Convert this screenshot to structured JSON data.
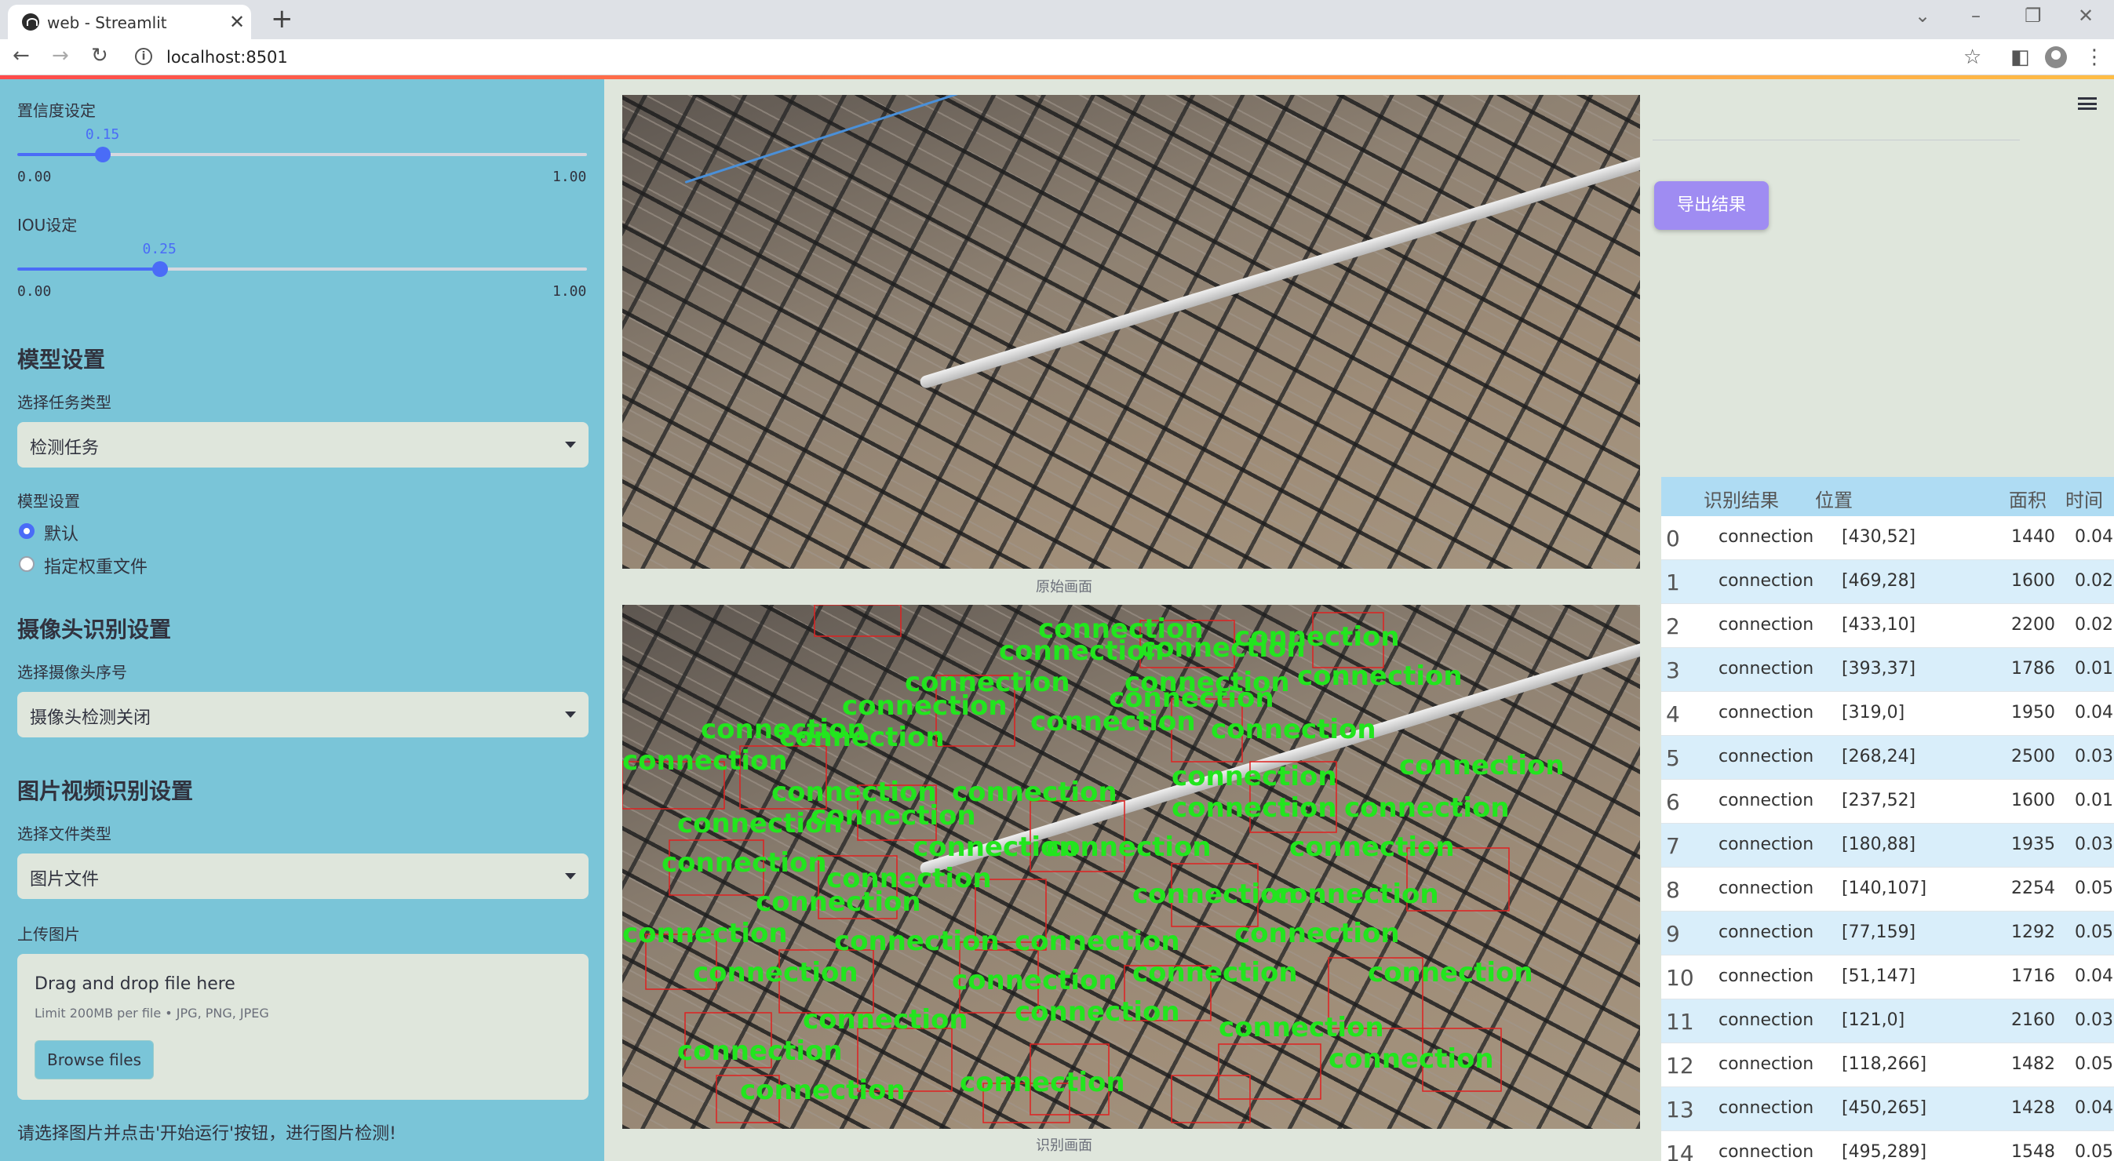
{
  "browser": {
    "tab_title": "web - Streamlit",
    "url": "localhost:8501"
  },
  "sidebar": {
    "confidence": {
      "label": "置信度设定",
      "value": "0.15",
      "fraction": 0.15,
      "min": "0.00",
      "max": "1.00"
    },
    "iou": {
      "label": "IOU设定",
      "value": "0.25",
      "fraction": 0.25,
      "min": "0.00",
      "max": "1.00"
    },
    "model_heading": "模型设置",
    "task_label": "选择任务类型",
    "task_value": "检测任务",
    "model_label": "模型设置",
    "model_options": [
      {
        "label": "默认",
        "checked": true
      },
      {
        "label": "指定权重文件",
        "checked": false
      }
    ],
    "camera_heading": "摄像头识别设置",
    "camera_label": "选择摄像头序号",
    "camera_value": "摄像头检测关闭",
    "media_heading": "图片视频识别设置",
    "filetype_label": "选择文件类型",
    "filetype_value": "图片文件",
    "upload_label": "上传图片",
    "upload_title": "Drag and drop file here",
    "upload_limit": "Limit 200MB per file • JPG, PNG, JPEG",
    "browse_label": "Browse files",
    "footer_hint": "请选择图片并点击'开始运行'按钮，进行图片检测!"
  },
  "main": {
    "original_caption": "原始画面",
    "detected_caption": "识别画面",
    "detection_label": "connection",
    "export_label": "导出结果",
    "colors": {
      "accent": "#4a6cf7",
      "sidebar": "#7ac5d8",
      "detection_text": "#22e51e",
      "detection_box": "#e02020",
      "export_button": "#9f8cf2"
    }
  },
  "table": {
    "columns": [
      "识别结果",
      "位置",
      "面积",
      "时间"
    ],
    "rows": [
      {
        "idx": "0",
        "result": "connection",
        "pos": "[430,52]",
        "area": "1440",
        "time": "0.04"
      },
      {
        "idx": "1",
        "result": "connection",
        "pos": "[469,28]",
        "area": "1600",
        "time": "0.02"
      },
      {
        "idx": "2",
        "result": "connection",
        "pos": "[433,10]",
        "area": "2200",
        "time": "0.02"
      },
      {
        "idx": "3",
        "result": "connection",
        "pos": "[393,37]",
        "area": "1786",
        "time": "0.01"
      },
      {
        "idx": "4",
        "result": "connection",
        "pos": "[319,0]",
        "area": "1950",
        "time": "0.04"
      },
      {
        "idx": "5",
        "result": "connection",
        "pos": "[268,24]",
        "area": "2500",
        "time": "0.03"
      },
      {
        "idx": "6",
        "result": "connection",
        "pos": "[237,52]",
        "area": "1600",
        "time": "0.01"
      },
      {
        "idx": "7",
        "result": "connection",
        "pos": "[180,88]",
        "area": "1935",
        "time": "0.03"
      },
      {
        "idx": "8",
        "result": "connection",
        "pos": "[140,107]",
        "area": "2254",
        "time": "0.05"
      },
      {
        "idx": "9",
        "result": "connection",
        "pos": "[77,159]",
        "area": "1292",
        "time": "0.05"
      },
      {
        "idx": "10",
        "result": "connection",
        "pos": "[51,147]",
        "area": "1716",
        "time": "0.04"
      },
      {
        "idx": "11",
        "result": "connection",
        "pos": "[121,0]",
        "area": "2160",
        "time": "0.03"
      },
      {
        "idx": "12",
        "result": "connection",
        "pos": "[118,266]",
        "area": "1482",
        "time": "0.05"
      },
      {
        "idx": "13",
        "result": "connection",
        "pos": "[450,265]",
        "area": "1428",
        "time": "0.04"
      },
      {
        "idx": "14",
        "result": "connection",
        "pos": "[495,289]",
        "area": "1548",
        "time": "0.05"
      }
    ]
  }
}
